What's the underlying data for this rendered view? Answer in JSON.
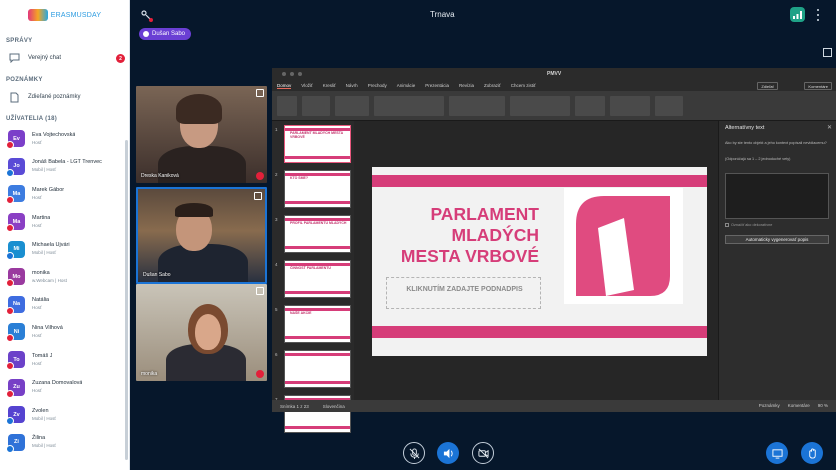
{
  "app": {
    "meeting_title": "Trnava",
    "logo_text": "ERASMUSDAY",
    "presenter_label": "Dušan Sabo",
    "user_initials": "DS"
  },
  "sidebar": {
    "messages_title": "SPRÁVY",
    "public_chat_label": "Verejný chat",
    "public_chat_badge": "2",
    "notes_title": "POZNÁMKY",
    "shared_notes_label": "Zdieľané poznámky",
    "users_title": "UŽÍVATELIA (18)",
    "users": [
      {
        "initials": "Ev",
        "name": "Eva Vojtechovská",
        "role": "Hosť",
        "color": "#7b3fc9",
        "status": "red"
      },
      {
        "initials": "Jo",
        "name": "Jonáš Babela - LGT Trenvec",
        "role": "Mobil | Hosť",
        "color": "#5a4bd6",
        "status": "blue"
      },
      {
        "initials": "Ma",
        "name": "Marek Gábor",
        "role": "Hosť",
        "color": "#3d7ce0",
        "status": "red"
      },
      {
        "initials": "Ma",
        "name": "Martina",
        "role": "Hosť",
        "color": "#8a3fc4",
        "status": "red"
      },
      {
        "initials": "Mi",
        "name": "Michaela Ujvári",
        "role": "Mobil | Hosť",
        "color": "#1a8fd0",
        "status": "blue"
      },
      {
        "initials": "Mo",
        "name": "monika",
        "role": "w.Webcam | Hosť",
        "color": "#9a3a9f",
        "status": "red"
      },
      {
        "initials": "Na",
        "name": "Natália",
        "role": "Hosť",
        "color": "#3e6ce0",
        "status": "red"
      },
      {
        "initials": "Ni",
        "name": "Nina Vilhová",
        "role": "Hosť",
        "color": "#2a7fd6",
        "status": "red"
      },
      {
        "initials": "To",
        "name": "Tomáš J",
        "role": "Hosť",
        "color": "#6b41c9",
        "status": "red"
      },
      {
        "initials": "Zu",
        "name": "Zuzana Domovalová",
        "role": "Hosť",
        "color": "#7740c6",
        "status": "red"
      },
      {
        "initials": "Zv",
        "name": "Zvolen",
        "role": "Mobil | Hosť",
        "color": "#5543d0",
        "status": "blue"
      },
      {
        "initials": "Zi",
        "name": "Žilina",
        "role": "Mobil | Hosť",
        "color": "#2f72d8",
        "status": "blue"
      }
    ]
  },
  "videos": [
    {
      "label": "Dreska Kaniková"
    },
    {
      "label": "Dušan Sabo"
    },
    {
      "label": "monika"
    }
  ],
  "powerpoint": {
    "file_name": "PMVV",
    "tabs": [
      "Domov",
      "Vložiť",
      "Kresliť",
      "Návrh",
      "Prechody",
      "Animácie",
      "Prezentácia",
      "Revízia",
      "Zobraziť",
      "Chcem zistiť"
    ],
    "active_tab": "Domov",
    "share_button": "Zdieľať",
    "comments_button": "Komentáre",
    "slide": {
      "title_lines": [
        "PARLAMENT",
        "MLADÝCH",
        "MESTA VRBOVÉ"
      ],
      "subtitle_placeholder": "KLIKNUTÍM ZADAJTE PODNADPIS"
    },
    "thumbnails": [
      {
        "num": "1",
        "title": "PARLAMENT MLADÝCH MESTA VRBOVÉ"
      },
      {
        "num": "2",
        "title": "KTO SME?"
      },
      {
        "num": "3",
        "title": "PROFIL PARLAMENTU MLADÝCH"
      },
      {
        "num": "4",
        "title": "ČINNOSŤ PARLAMENTU"
      },
      {
        "num": "5",
        "title": "NAŠE AKCIE"
      },
      {
        "num": "6",
        "title": ""
      },
      {
        "num": "7",
        "title": ""
      }
    ],
    "alt_text": {
      "title": "Alternatívny text",
      "description": "Ako by ste tento objekt a jeho kontext popísali nevidiacemu?",
      "hint": "(Odporúčajú sa 1 – 2 jednoduché vety)",
      "decorative_label": "Označiť ako dekoratívne",
      "generate_button": "Automaticky vygenerovať popis"
    },
    "status": {
      "slide_counter": "Snímka 1 z 23",
      "language": "Slovenčina",
      "notes": "Poznámky",
      "comments": "Komentáre",
      "zoom": "90 %"
    }
  }
}
